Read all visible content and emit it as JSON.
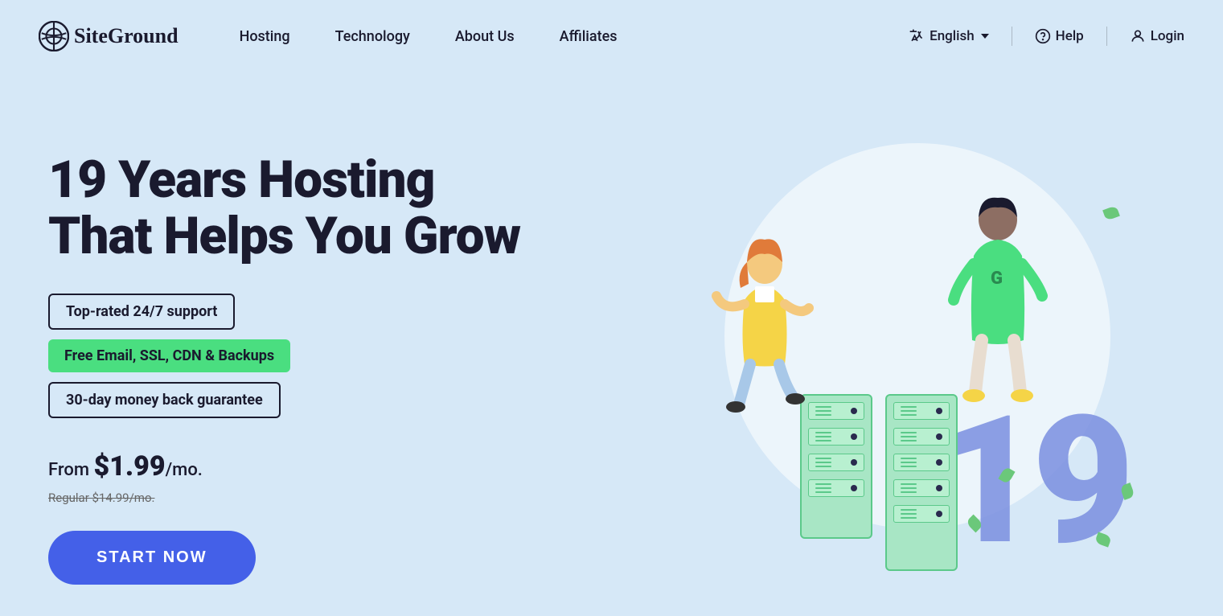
{
  "logo": {
    "text": "SiteGround"
  },
  "nav": {
    "links": [
      {
        "label": "Hosting"
      },
      {
        "label": "Technology"
      },
      {
        "label": "About Us"
      },
      {
        "label": "Affiliates"
      }
    ],
    "language": "English",
    "help": "Help",
    "login": "Login"
  },
  "hero": {
    "title_line1": "19 Years Hosting",
    "title_line2": "That Helps You Grow",
    "badges": [
      {
        "text": "Top-rated 24/7 support",
        "type": "outline"
      },
      {
        "text": "Free Email, SSL, CDN & Backups",
        "type": "green"
      },
      {
        "text": "30-day money back guarantee",
        "type": "outline"
      }
    ],
    "pricing": {
      "from_label": "From ",
      "amount": "$1.99",
      "period": "/mo.",
      "regular_label": "Regular ",
      "regular_price": "$14.99/mo."
    },
    "cta_button": "START NOW",
    "illustration_number": "19"
  }
}
